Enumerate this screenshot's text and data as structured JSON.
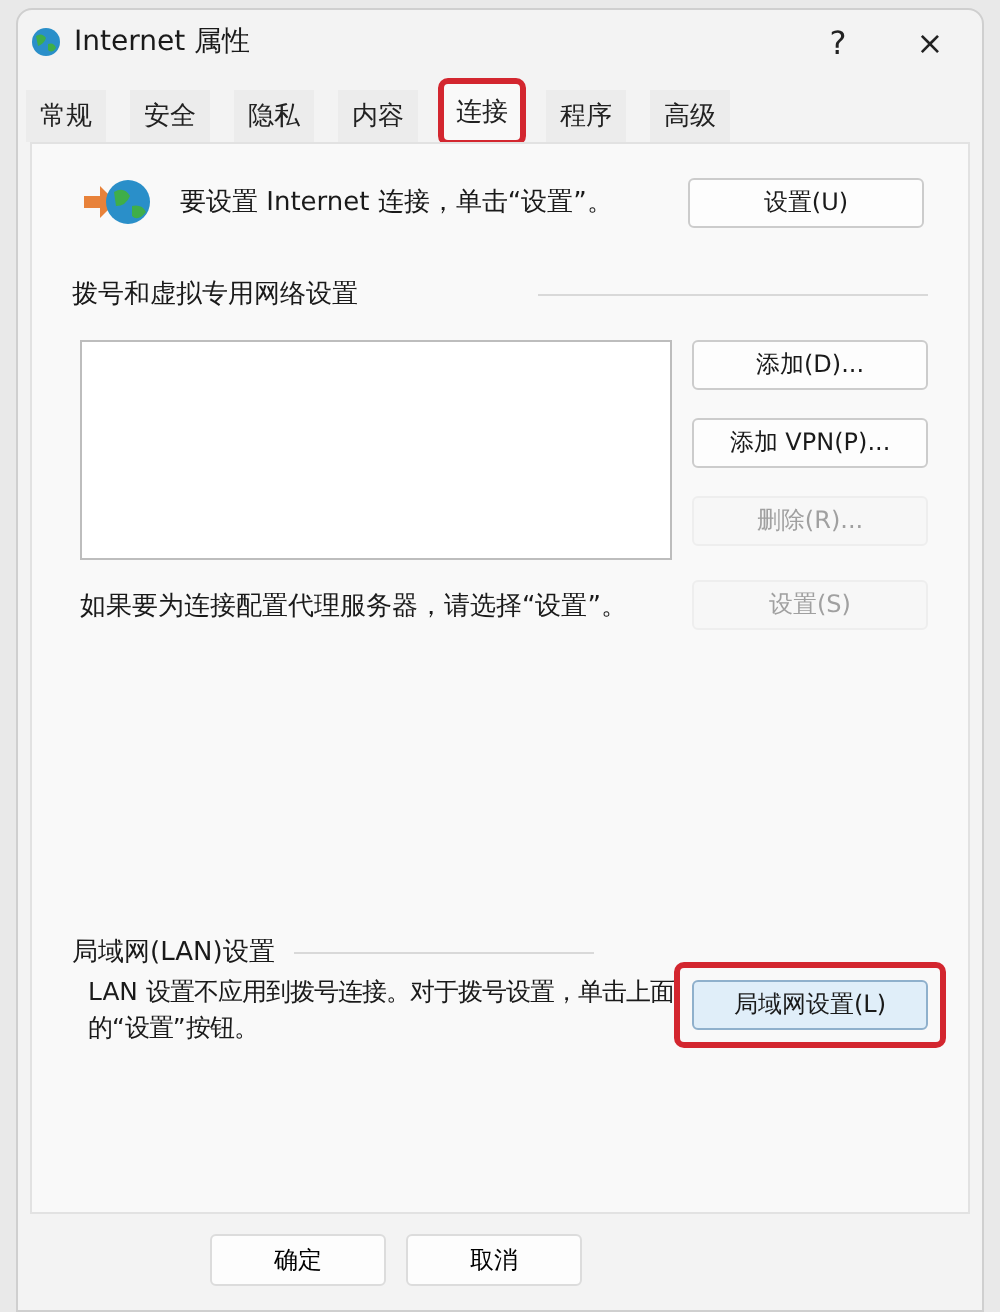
{
  "window": {
    "title": "Internet 属性",
    "help": "?",
    "close": "×"
  },
  "tabs": [
    {
      "label": "常规",
      "selected": false,
      "highlighted": false
    },
    {
      "label": "安全",
      "selected": false,
      "highlighted": false
    },
    {
      "label": "隐私",
      "selected": false,
      "highlighted": false
    },
    {
      "label": "内容",
      "selected": false,
      "highlighted": false
    },
    {
      "label": "连接",
      "selected": true,
      "highlighted": true
    },
    {
      "label": "程序",
      "selected": false,
      "highlighted": false
    },
    {
      "label": "高级",
      "selected": false,
      "highlighted": false
    }
  ],
  "setup": {
    "text": "要设置 Internet 连接，单击“设置”。",
    "button": "设置(U)"
  },
  "dialup": {
    "heading": "拨号和虚拟专用网络设置",
    "buttons": [
      {
        "label": "添加(D)...",
        "disabled": false
      },
      {
        "label": "添加 VPN(P)...",
        "disabled": false
      },
      {
        "label": "删除(R)...",
        "disabled": true
      }
    ],
    "proxy_text": "如果要为连接配置代理服务器，请选择“设置”。",
    "proxy_button": {
      "label": "设置(S)",
      "disabled": true
    }
  },
  "lan": {
    "heading": "局域网(LAN)设置",
    "text": "LAN 设置不应用到拨号连接。对于拨号设置，单击上面的“设置”按钮。",
    "button": "局域网设置(L)",
    "highlighted": true
  },
  "footer_buttons": [
    "确定",
    "取消"
  ]
}
